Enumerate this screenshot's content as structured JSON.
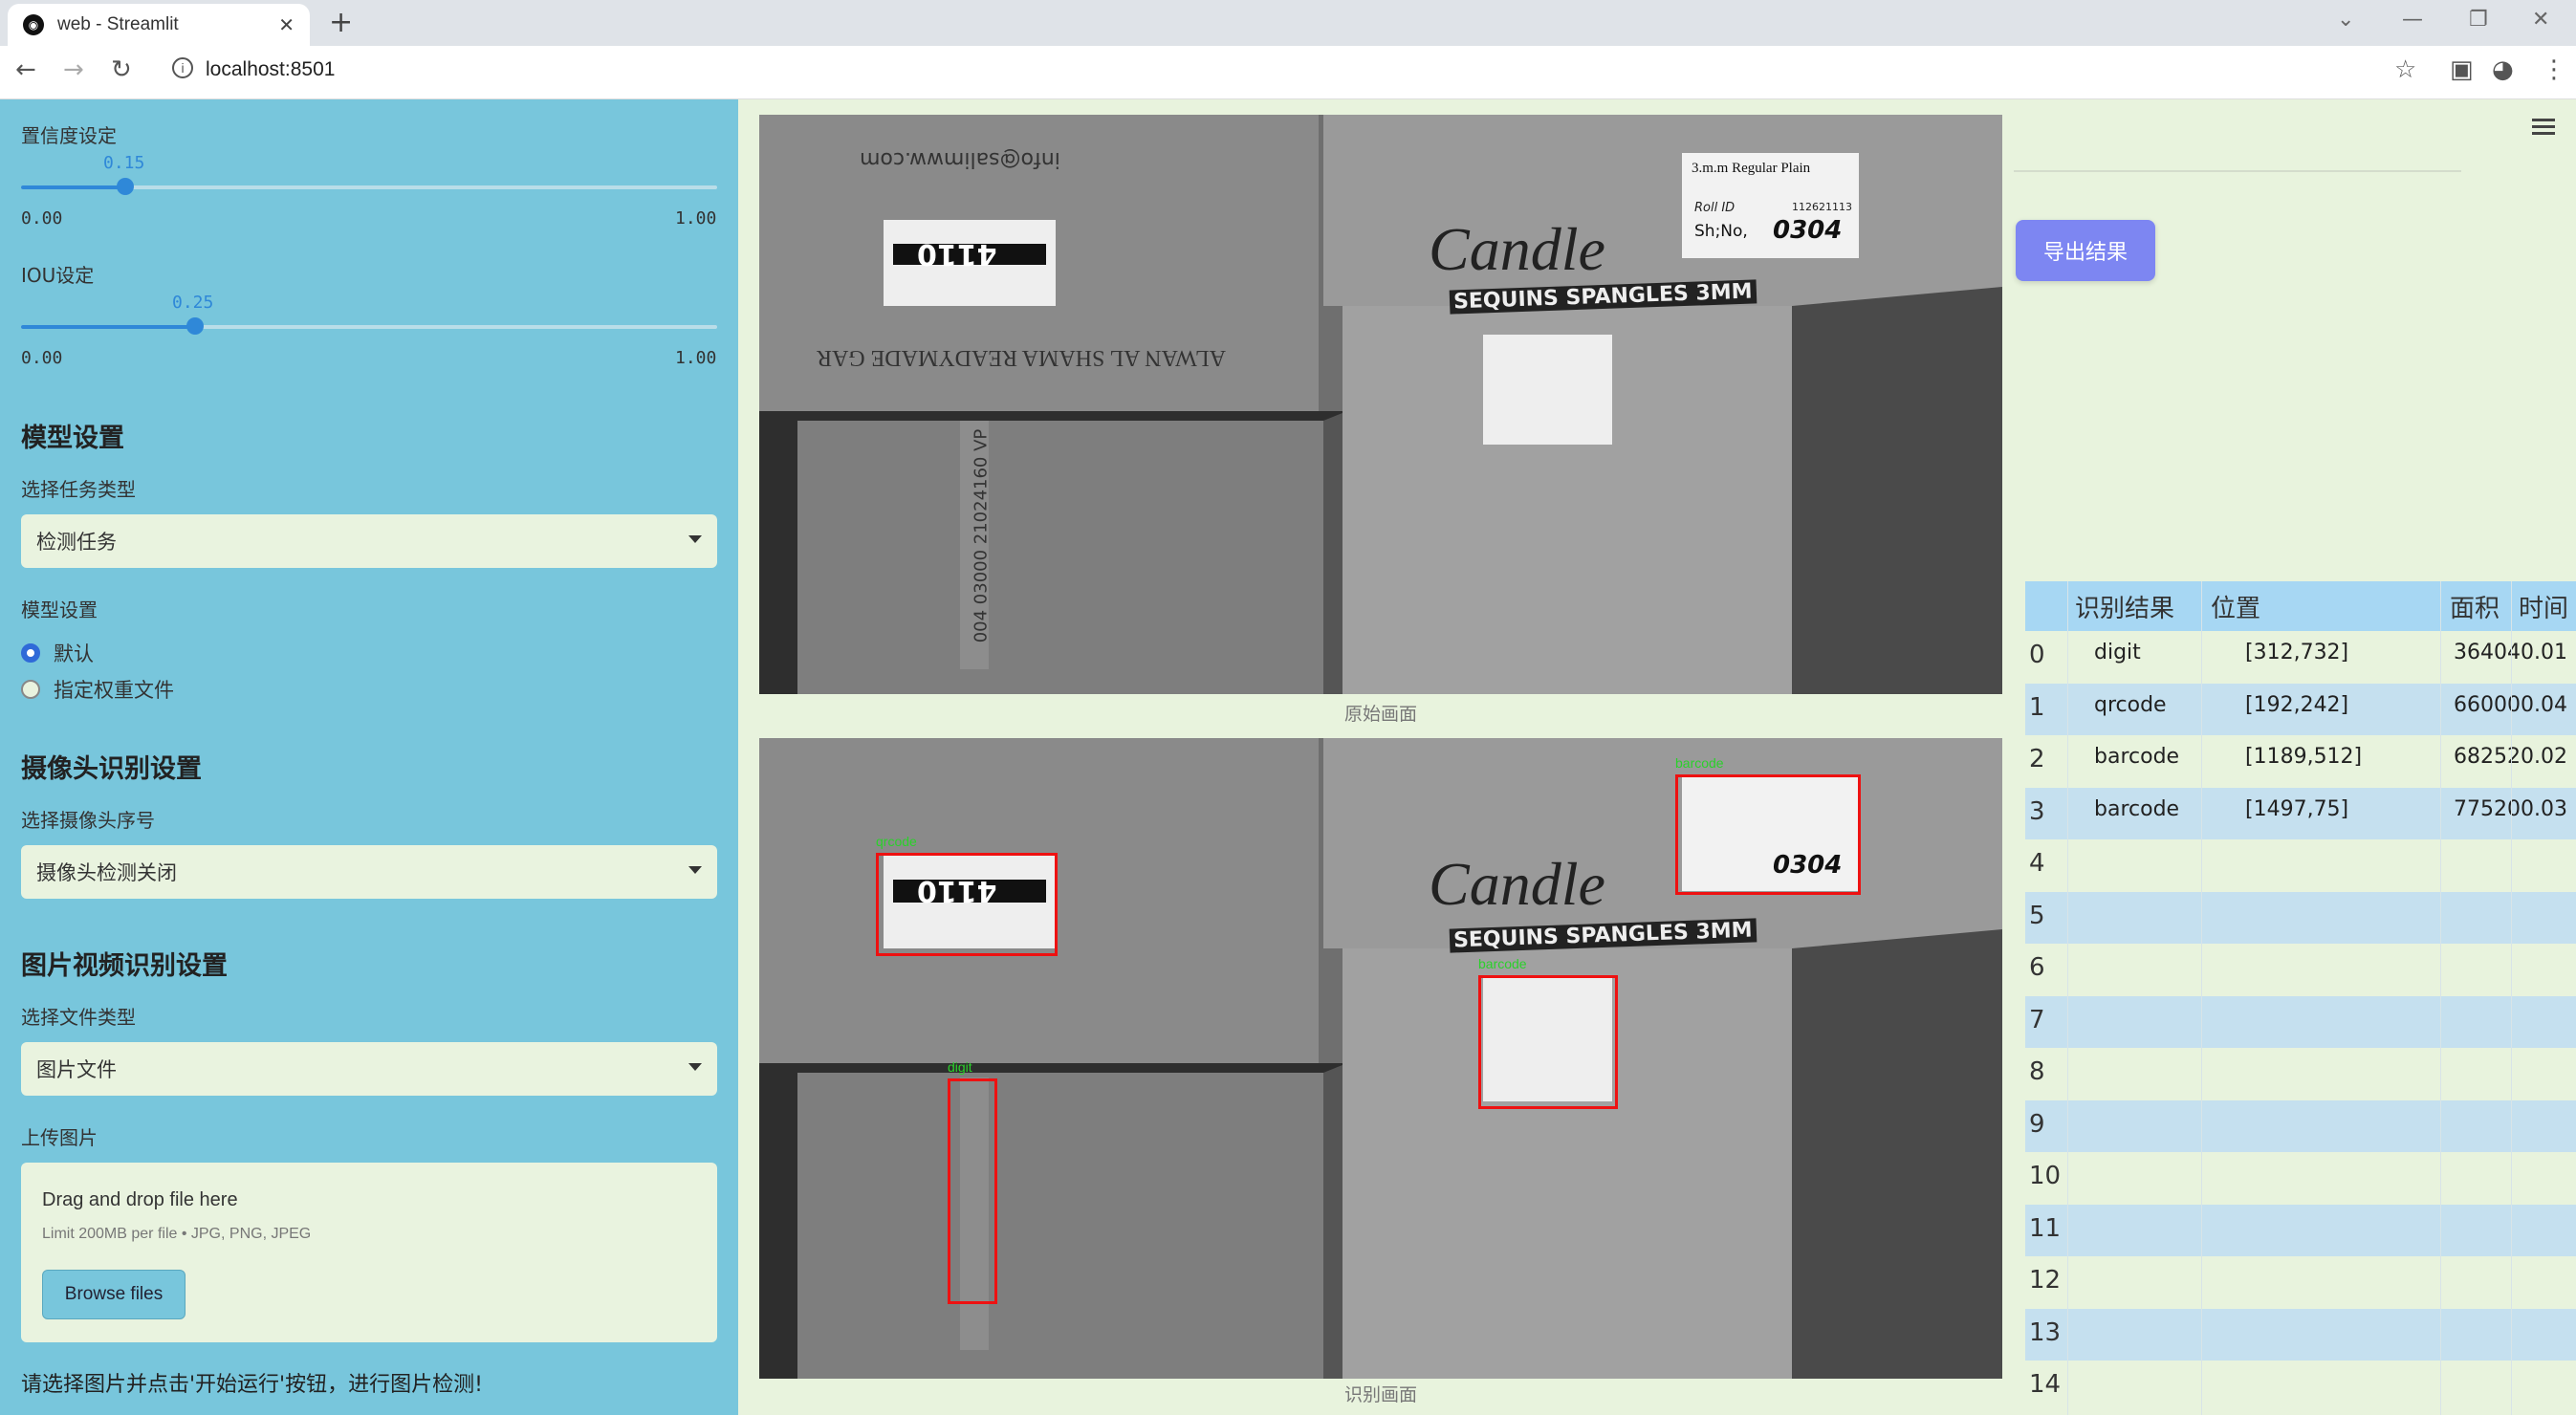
{
  "browser": {
    "tab_title": "web - Streamlit",
    "url": "localhost:8501"
  },
  "sidebar": {
    "confidence_label": "置信度设定",
    "confidence_value": "0.15",
    "confidence_fraction": 0.15,
    "confidence_min": "0.00",
    "confidence_max": "1.00",
    "iou_label": "IOU设定",
    "iou_value": "0.25",
    "iou_fraction": 0.25,
    "iou_min": "0.00",
    "iou_max": "1.00",
    "model_heading": "模型设置",
    "task_type_label": "选择任务类型",
    "task_type_value": "检测任务",
    "model_settings_label": "模型设置",
    "radio_default": "默认",
    "radio_custom": "指定权重文件",
    "camera_heading": "摄像头识别设置",
    "camera_select_label": "选择摄像头序号",
    "camera_select_value": "摄像头检测关闭",
    "media_heading": "图片视频识别设置",
    "file_type_label": "选择文件类型",
    "file_type_value": "图片文件",
    "upload_label": "上传图片",
    "upload_title": "Drag and drop file here",
    "upload_limit": "Limit 200MB per file • JPG, PNG, JPEG",
    "browse_button": "Browse files",
    "hint": "请选择图片并点击'开始运行'按钮，进行图片检测!"
  },
  "main": {
    "original_caption": "原始画面",
    "result_caption": "识别画面",
    "export_button": "导出结果",
    "detections": [
      {
        "label": "qrcode"
      },
      {
        "label": "barcode"
      },
      {
        "label": "barcode"
      },
      {
        "label": "digit"
      }
    ],
    "scene_text": {
      "box_label_top": "3.m.m Regular Plain",
      "roll_id": "Roll ID",
      "roll_num": "112621113",
      "sh_no": "Sh;No,",
      "num": "0304",
      "candle": "Candle",
      "sequins": "SEQUINS SPANGLES 3MM",
      "alwan": "ALWAN AL SHAMA READYMADE GAR",
      "email": "info@salimww.com",
      "code": "4110",
      "vertical": "004 03000 21024160 VP"
    }
  },
  "table": {
    "headers": [
      "识别结果",
      "位置",
      "面积",
      "时间"
    ],
    "rows": [
      {
        "idx": "0",
        "result": "digit",
        "pos": "[312,732]",
        "area": "36404",
        "time": "0.01"
      },
      {
        "idx": "1",
        "result": "qrcode",
        "pos": "[192,242]",
        "area": "66000",
        "time": "0.04"
      },
      {
        "idx": "2",
        "result": "barcode",
        "pos": "[1189,512]",
        "area": "68252",
        "time": "0.02"
      },
      {
        "idx": "3",
        "result": "barcode",
        "pos": "[1497,75]",
        "area": "77520",
        "time": "0.03"
      },
      {
        "idx": "4",
        "result": "",
        "pos": "",
        "area": "",
        "time": ""
      },
      {
        "idx": "5",
        "result": "",
        "pos": "",
        "area": "",
        "time": ""
      },
      {
        "idx": "6",
        "result": "",
        "pos": "",
        "area": "",
        "time": ""
      },
      {
        "idx": "7",
        "result": "",
        "pos": "",
        "area": "",
        "time": ""
      },
      {
        "idx": "8",
        "result": "",
        "pos": "",
        "area": "",
        "time": ""
      },
      {
        "idx": "9",
        "result": "",
        "pos": "",
        "area": "",
        "time": ""
      },
      {
        "idx": "10",
        "result": "",
        "pos": "",
        "area": "",
        "time": ""
      },
      {
        "idx": "11",
        "result": "",
        "pos": "",
        "area": "",
        "time": ""
      },
      {
        "idx": "12",
        "result": "",
        "pos": "",
        "area": "",
        "time": ""
      },
      {
        "idx": "13",
        "result": "",
        "pos": "",
        "area": "",
        "time": ""
      },
      {
        "idx": "14",
        "result": "",
        "pos": "",
        "area": "",
        "time": ""
      }
    ]
  },
  "colors": {
    "sidebar_bg": "#78c6dc",
    "main_bg": "#e8f3dd",
    "accent": "#2f88d8",
    "export_button": "#7d86f2",
    "detection_box": "#ee1111",
    "detection_label": "#2ad12a"
  }
}
